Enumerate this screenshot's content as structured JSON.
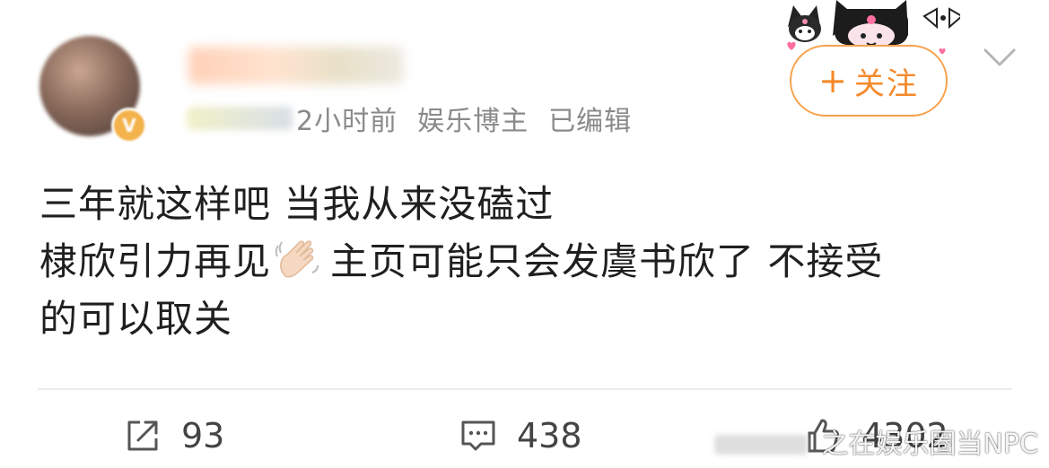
{
  "post": {
    "meta": {
      "time": "2小时前",
      "category": "娱乐博主",
      "edited": "已编辑"
    },
    "follow_button": {
      "plus": "+",
      "label": "关注"
    },
    "text_lines": [
      "三年就这样吧 当我从来没磕过",
      "棣欣引力再见",
      "主页可能只会发虞书欣了 不接受",
      "的可以取关"
    ],
    "emoji": "waving-hand"
  },
  "actions": {
    "repost_count": "93",
    "comment_count": "438",
    "like_count": "4302"
  },
  "watermark": {
    "text": "之在娱乐圈当NPC"
  },
  "colors": {
    "accent": "#f5892a",
    "follow_border": "#f6a24c",
    "meta_text": "#8a8a8a",
    "body_text": "#1f1f1f",
    "divider": "#ececec"
  }
}
